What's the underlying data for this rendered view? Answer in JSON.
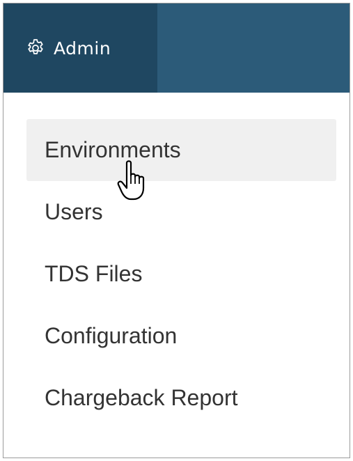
{
  "header": {
    "admin_label": "Admin",
    "admin_icon": "gear-icon",
    "tab_color": "#1f4761",
    "bar_color": "#2c5b79"
  },
  "menu": {
    "items": [
      {
        "label": "Environments",
        "hovered": true
      },
      {
        "label": "Users"
      },
      {
        "label": "TDS Files"
      },
      {
        "label": "Configuration"
      },
      {
        "label": "Chargeback Report"
      }
    ]
  },
  "cursor": {
    "icon": "hand-pointer-icon"
  }
}
